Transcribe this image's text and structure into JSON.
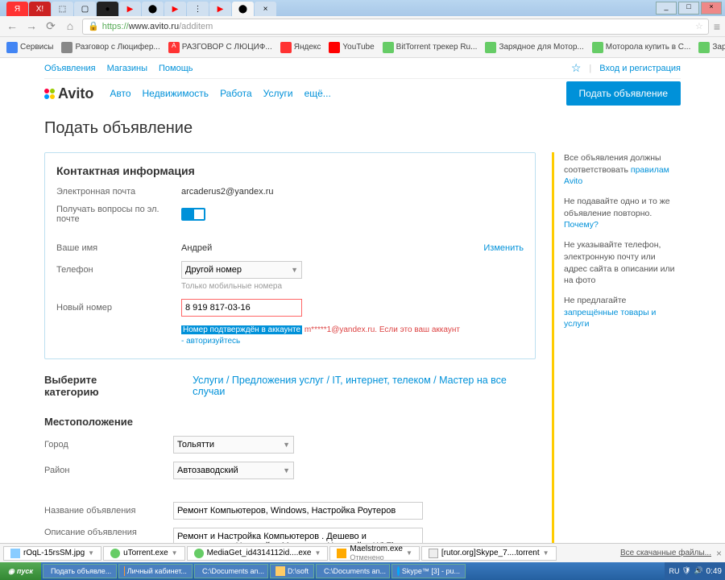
{
  "browser": {
    "url_proto": "https://",
    "url_host": "www.avito.ru",
    "url_path": "/additem",
    "bookmarks": [
      "Сервисы",
      "Разговор с Люцифер...",
      "РАЗГОВОР С ЛЮЦИФ...",
      "Яндекс",
      "YouTube",
      "BitTorrent трекер Ru...",
      "Зарядное для Мотор...",
      "Моторола купить в С...",
      "Зарядки с различны..."
    ]
  },
  "util": {
    "ads": "Объявления",
    "shops": "Магазины",
    "help": "Помощь",
    "auth": "Вход и регистрация"
  },
  "logo_text": "Avito",
  "nav": {
    "auto": "Авто",
    "realty": "Недвижимость",
    "jobs": "Работа",
    "services": "Услуги",
    "more": "ещё..."
  },
  "post_btn": "Подать объявление",
  "page_title": "Подать объявление",
  "contact": {
    "title": "Контактная информация",
    "email_lbl": "Электронная почта",
    "email_val": "arcaderus2@yandex.ru",
    "receive_lbl": "Получать вопросы по эл. почте",
    "name_lbl": "Ваше имя",
    "name_val": "Андрей",
    "change": "Изменить",
    "phone_lbl": "Телефон",
    "phone_sel": "Другой номер",
    "phone_hint": "Только мобильные номера",
    "newnum_lbl": "Новый номер",
    "newnum_val": "8 919 817-03-16",
    "confirm_hl": "Номер подтверждён в аккаунте",
    "confirm_red": " m*****1@yandex.ru. Если это ваш аккаунт",
    "confirm_link": "- авторизуйтесь"
  },
  "side": {
    "p1a": "Все объявления должны соответствовать ",
    "p1l": "правилам Avito",
    "p2a": "Не подавайте одно и то же объявление повторно. ",
    "p2l": "Почему?",
    "p3": "Не указывайте телефон, электронную почту или адрес сайта в описании или на фото",
    "p4a": "Не предлагайте ",
    "p4l": "запрещённые товары и услуги"
  },
  "cat": {
    "title": "Выберите категорию",
    "breadcrumb": "Услуги / Предложения услуг / IT, интернет, телеком / Мастер на все случаи"
  },
  "loc": {
    "title": "Местоположение",
    "city_lbl": "Город",
    "city_val": "Тольятти",
    "district_lbl": "Район",
    "district_val": "Автозаводский"
  },
  "ad": {
    "title_lbl": "Название объявления",
    "title_val": "Ремонт Компьютеров, Windows, Настройка Роутеров",
    "desc_lbl": "Описание объявления",
    "desc_val": "Ремонт и Настройка Компьютеров . Дешево и качественно , Настройка Модемов , Настройка Wi Fi Роутеров - 350 рублей - подскажу где и какой лучше купить . Установка Windows - 500"
  },
  "downloads": {
    "items": [
      {
        "name": "rOqL-15rsSM.jpg"
      },
      {
        "name": "uTorrent.exe"
      },
      {
        "name": "MediaGet_id4314112id....exe"
      },
      {
        "name": "Maelstrom.exe",
        "sub": "Отменено"
      },
      {
        "name": "[rutor.org]Skype_7....torrent"
      }
    ],
    "all": "Все скачанные файлы..."
  },
  "taskbar": {
    "start": "пуск",
    "items": [
      "Подать объявле...",
      "Личный кабинет...",
      "C:\\Documents an...",
      "D:\\soft",
      "C:\\Documents an...",
      "Skype™ [3] - pu..."
    ],
    "lang": "RU",
    "time": "0:49"
  }
}
